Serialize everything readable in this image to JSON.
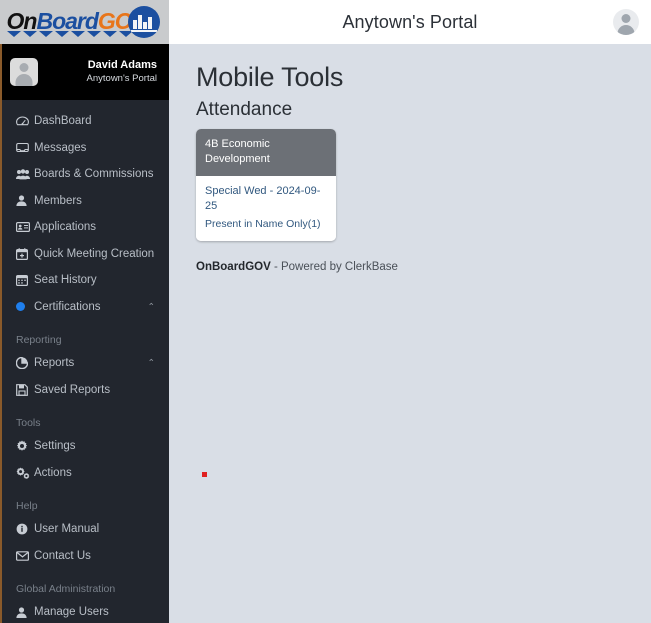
{
  "brand": {
    "logo_text_on": "On",
    "logo_text_board": "Board",
    "logo_text_gov": "GOV",
    "accent_blue": "#1b4fa0",
    "accent_orange": "#e8751a"
  },
  "header": {
    "title": "Anytown's Portal",
    "avatar_icon": "user-avatar-icon"
  },
  "profile": {
    "name": "David Adams",
    "org": "Anytown's Portal",
    "avatar_icon": "user-avatar-icon"
  },
  "sidebar": {
    "items": [
      {
        "label": "DashBoard",
        "icon": "dashboard-icon",
        "glyph": "⚙"
      },
      {
        "label": "Messages",
        "icon": "message-icon",
        "glyph": "✉"
      },
      {
        "label": "Boards & Commissions",
        "icon": "group-icon",
        "glyph": "♟"
      },
      {
        "label": "Members",
        "icon": "person-icon",
        "glyph": "♟"
      },
      {
        "label": "Applications",
        "icon": "id-card-icon",
        "glyph": "▤"
      },
      {
        "label": "Quick Meeting Creation",
        "icon": "calendar-plus-icon",
        "glyph": "▦"
      },
      {
        "label": "Seat History",
        "icon": "calendar-icon",
        "glyph": "▦"
      },
      {
        "label": "Certifications",
        "icon": "certification-dot-icon",
        "glyph": "",
        "chevron": "⌃"
      }
    ],
    "sections": [
      {
        "heading": "Reporting",
        "items": [
          {
            "label": "Reports",
            "icon": "pie-chart-icon",
            "glyph": "◔",
            "chevron": "⌃"
          },
          {
            "label": "Saved Reports",
            "icon": "save-disk-icon",
            "glyph": "▣"
          }
        ]
      },
      {
        "heading": "Tools",
        "items": [
          {
            "label": "Settings",
            "icon": "gear-icon",
            "glyph": "⚙"
          },
          {
            "label": "Actions",
            "icon": "gears-icon",
            "glyph": "⚙"
          }
        ]
      },
      {
        "heading": "Help",
        "items": [
          {
            "label": "User Manual",
            "icon": "info-circle-icon",
            "glyph": "ⓘ"
          },
          {
            "label": "Contact Us",
            "icon": "envelope-icon",
            "glyph": "✉"
          }
        ]
      },
      {
        "heading": "Global Administration",
        "items": [
          {
            "label": "Manage Users",
            "icon": "person-icon",
            "glyph": "♟"
          }
        ]
      }
    ]
  },
  "main": {
    "page_title": "Mobile Tools",
    "section_title": "Attendance",
    "cards": [
      {
        "board_name": "4B Economic Development",
        "meeting_link": "Special Wed - 2024-09-25",
        "status": "Present in Name Only(1)"
      }
    ],
    "footer": {
      "brand": "OnBoardGOV",
      "tagline": " - Powered by ClerkBase"
    }
  }
}
